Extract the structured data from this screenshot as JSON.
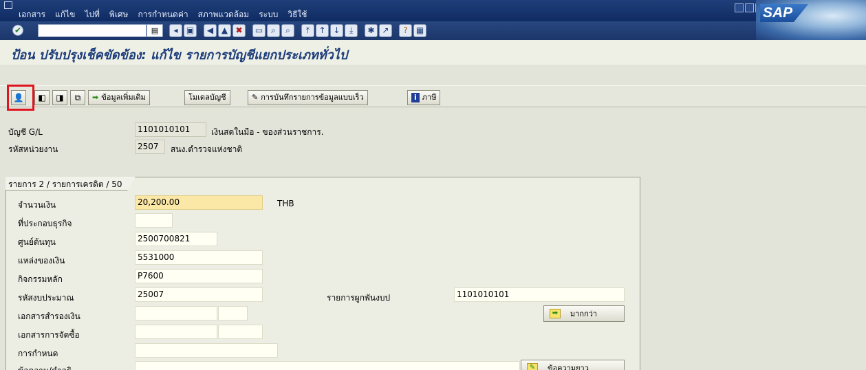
{
  "menu": [
    "เอกสาร",
    "แก้ไข",
    "ไปที่",
    "พิเศษ",
    "การกำหนดค่า",
    "สภาพแวดล้อม",
    "ระบบ",
    "วิธีใช้"
  ],
  "logo": "SAP",
  "toolbar": {
    "command_value": "",
    "icons": [
      "back-icon",
      "save-icon",
      "nav-back-icon",
      "exit-icon",
      "cancel-icon",
      "print-icon",
      "find-icon",
      "find-next-icon",
      "first-page-icon",
      "prev-page-icon",
      "next-page-icon",
      "last-page-icon",
      "new-session-icon",
      "shortcut-icon",
      "help-icon",
      "layout-icon"
    ]
  },
  "screen_title": "ป้อน ปรับปรุงเช็คขัดข้อง: แก้ไข รายการบัญชีแยกประเภททั่วไป",
  "app_toolbar": {
    "more_data": "ข้อมูลเพิ่มเติม",
    "account_model": "โมเดลบัญชี",
    "fast_entry": "การบันทึกรายการข้อมูลแบบเร็ว",
    "taxes": "ภาษี"
  },
  "header": {
    "gl_account_label": "บัญชี G/L",
    "gl_account_value": "1101010101",
    "gl_account_desc": "เงินสดในมือ - ของส่วนราชการ.",
    "business_unit_label": "รหัสหน่วยงาน",
    "business_unit_value": "2507",
    "business_unit_desc": "สนง.ตำรวจแห่งชาติ"
  },
  "item": {
    "tab_title": "รายการ 2 / รายการเครดิต / 50",
    "amount_label": "จำนวนเงิน",
    "amount_value": "20,200.00",
    "currency": "THB",
    "business_area_label": "ที่ประกอบธุรกิจ",
    "business_area_value": "",
    "cost_center_label": "ศูนย์ต้นทุน",
    "cost_center_value": "2500700821",
    "fund_label": "แหล่งของเงิน",
    "fund_value": "5531000",
    "main_activity_label": "กิจกรรมหลัก",
    "main_activity_value": "P7600",
    "budget_code_label": "รหัสงบประมาณ",
    "budget_code_value": "25007",
    "binding_label": "รายการผูกพันงบป",
    "binding_value": "1101010101",
    "earmark_label": "เอกสารสำรองเงิน",
    "po_label": "เอกสารการจัดซื้อ",
    "assignment_label": "การกำหนด",
    "text_label": "ข้อความ/คำอธิ",
    "more_button": "มากกว่า",
    "long_text_button": "ข้อความยาว"
  }
}
